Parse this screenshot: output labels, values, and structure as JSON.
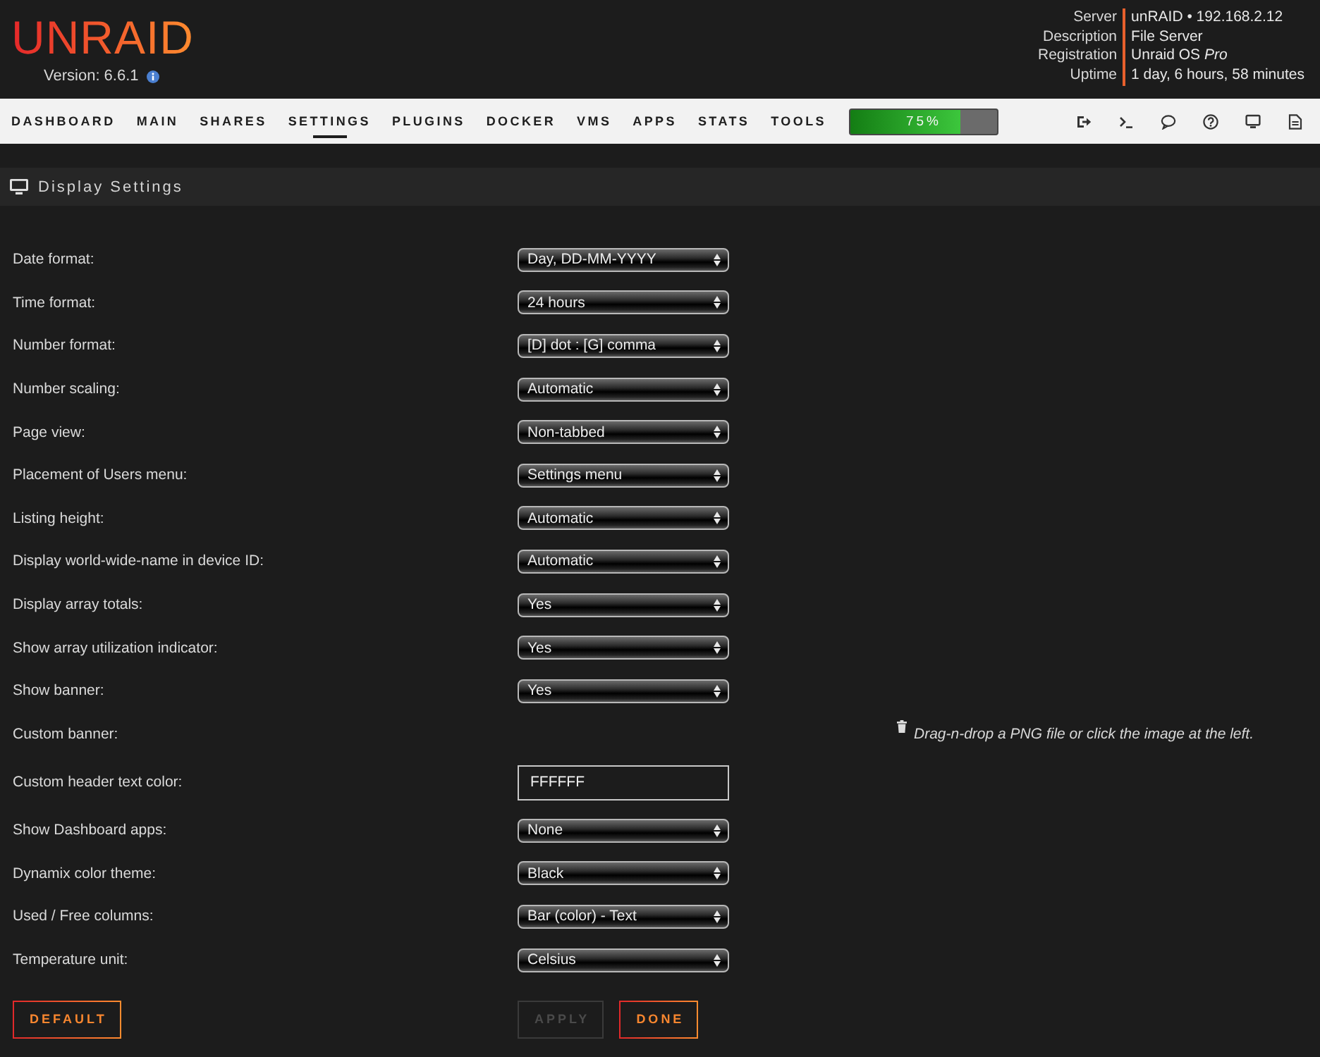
{
  "header": {
    "logo": "UNRAID",
    "version": "Version: 6.6.1",
    "server_info": [
      {
        "label": "Server",
        "value": "unRAID • 192.168.2.12"
      },
      {
        "label": "Description",
        "value": "File Server"
      },
      {
        "label": "Registration",
        "value": "Unraid OS *Pro*"
      },
      {
        "label": "Uptime",
        "value": "1 day, 6 hours, 58 minutes"
      }
    ]
  },
  "nav": {
    "tabs": [
      {
        "label": "DASHBOARD",
        "selected": false
      },
      {
        "label": "MAIN",
        "selected": false
      },
      {
        "label": "SHARES",
        "selected": false
      },
      {
        "label": "SETTINGS",
        "selected": true
      },
      {
        "label": "PLUGINS",
        "selected": false
      },
      {
        "label": "DOCKER",
        "selected": false
      },
      {
        "label": "VMS",
        "selected": false
      },
      {
        "label": "APPS",
        "selected": false
      },
      {
        "label": "STATS",
        "selected": false
      },
      {
        "label": "TOOLS",
        "selected": false
      }
    ],
    "utilization": {
      "level": 0.75,
      "reading": "75%"
    }
  },
  "section": {
    "title": "Display Settings"
  },
  "settings": [
    {
      "kind": "select",
      "label": "Date format:",
      "value": "Day, DD-MM-YYYY"
    },
    {
      "kind": "select",
      "label": "Time format:",
      "value": "24 hours"
    },
    {
      "kind": "select",
      "label": "Number format:",
      "value": "[D] dot : [G] comma"
    },
    {
      "kind": "select",
      "label": "Number scaling:",
      "value": "Automatic"
    },
    {
      "kind": "select",
      "label": "Page view:",
      "value": "Non-tabbed"
    },
    {
      "kind": "select",
      "label": "Placement of Users menu:",
      "value": "Settings menu"
    },
    {
      "kind": "select",
      "label": "Listing height:",
      "value": "Automatic"
    },
    {
      "kind": "select",
      "label": "Display world-wide-name in device ID:",
      "value": "Automatic"
    },
    {
      "kind": "select",
      "label": "Display array totals:",
      "value": "Yes"
    },
    {
      "kind": "select",
      "label": "Show array utilization indicator:",
      "value": "Yes"
    },
    {
      "kind": "select",
      "label": "Show banner:",
      "value": "Yes"
    },
    {
      "kind": "upload",
      "label": "Custom banner:",
      "hint": "Drag-n-drop a PNG file or click the image at the left."
    },
    {
      "kind": "text",
      "label": "Custom header text color:",
      "value": "FFFFFF"
    },
    {
      "kind": "select",
      "label": "Show Dashboard apps:",
      "value": "None"
    },
    {
      "kind": "select",
      "label": "Dynamix color theme:",
      "value": "Black"
    },
    {
      "kind": "select",
      "label": "Used / Free columns:",
      "value": "Bar (color) - Text"
    },
    {
      "kind": "select",
      "label": "Temperature unit:",
      "value": "Celsius"
    }
  ],
  "footer_left": [
    {
      "label": "DEFAULT",
      "disabled": false
    }
  ],
  "footer_right": [
    {
      "label": "APPLY",
      "disabled": true
    },
    {
      "label": "DONE",
      "disabled": false
    }
  ]
}
